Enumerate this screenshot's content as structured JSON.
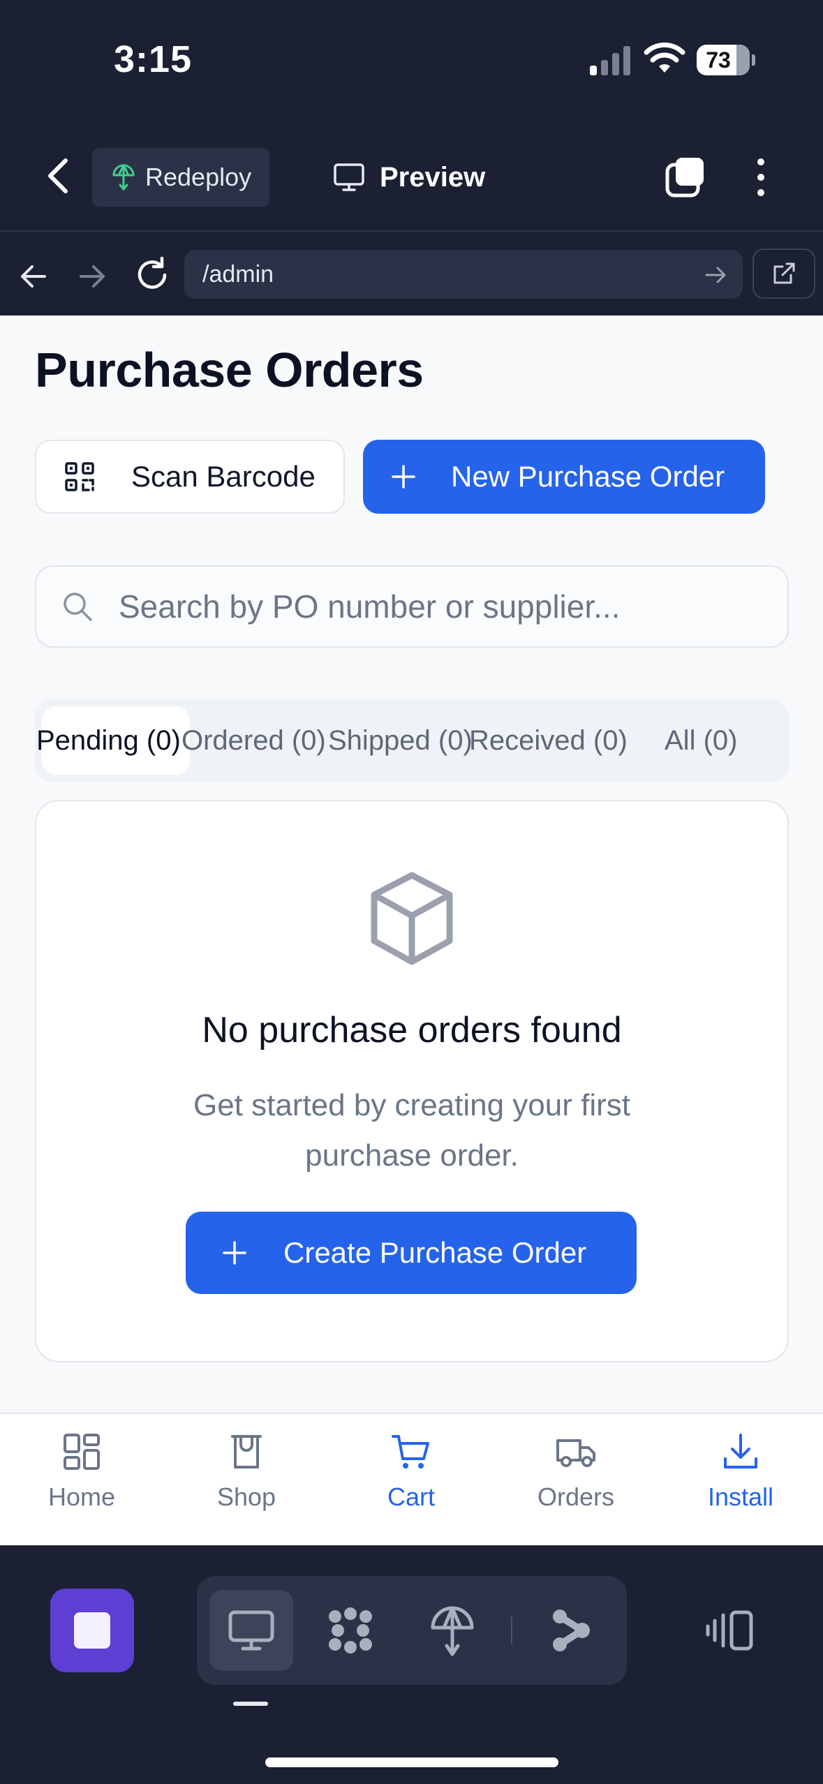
{
  "status_bar": {
    "time": "3:15",
    "battery": "73"
  },
  "header": {
    "redeploy_label": "Redeploy",
    "preview_label": "Preview"
  },
  "browser": {
    "url": "/admin"
  },
  "page": {
    "title": "Purchase Orders",
    "scan_button": "Scan Barcode",
    "new_button": "New Purchase Order",
    "search_placeholder": "Search by PO number or supplier...",
    "tabs": [
      {
        "label": "Pending (0)",
        "active": true
      },
      {
        "label": "Ordered (0)"
      },
      {
        "label": "Shipped (0)"
      },
      {
        "label": "Received (0)"
      },
      {
        "label": "All (0)"
      }
    ],
    "empty_state": {
      "title": "No purchase orders found",
      "description": "Get started by creating your first purchase order.",
      "button": "Create Purchase Order"
    }
  },
  "bottom_nav": [
    {
      "label": "Home",
      "icon": "grid-icon"
    },
    {
      "label": "Shop",
      "icon": "shop-icon"
    },
    {
      "label": "Cart",
      "icon": "cart-icon",
      "active": true
    },
    {
      "label": "Orders",
      "icon": "truck-icon"
    },
    {
      "label": "Install",
      "icon": "download-icon"
    }
  ],
  "colors": {
    "accent": "#2563eb",
    "header_bg": "#1b2033",
    "dock_app": "#5d3fd3"
  }
}
